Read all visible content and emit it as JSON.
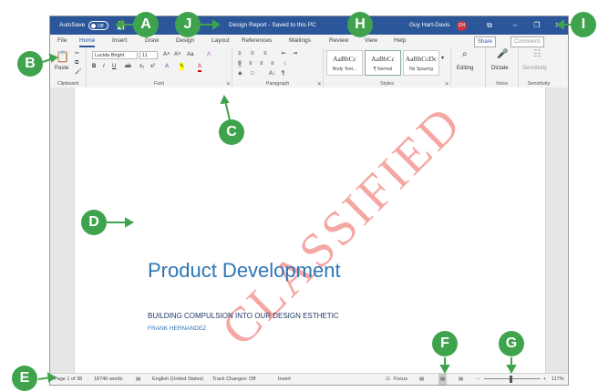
{
  "titlebar": {
    "autosave": "AutoSave",
    "autosave_state": "Off",
    "save_icon": "save-icon",
    "document_title": "Design Report - Saved to this PC",
    "user_name": "Guy Hart-Davis",
    "user_initials": "GH",
    "ribbon_display_glyph": "⧉",
    "minimize_glyph": "–",
    "restore_glyph": "❐",
    "close_glyph": "✕"
  },
  "tabs": [
    "File",
    "Home",
    "Insert",
    "Draw",
    "Design",
    "Layout",
    "References",
    "Mailings",
    "Review",
    "View",
    "Help"
  ],
  "active_tab": "Home",
  "share_label": "Share",
  "comments_label": "Comments",
  "ribbon": {
    "clipboard": {
      "label": "Clipboard",
      "paste": "Paste"
    },
    "font": {
      "label": "Font",
      "name": "Lucida Bright",
      "size": "11",
      "grow": "A˄",
      "shrink": "A˅",
      "case": "Aa",
      "clear": "A",
      "bold": "B",
      "italic": "I",
      "underline": "U",
      "strike": "ab",
      "subscript": "x₂",
      "superscript": "x²",
      "effects": "A",
      "highlight": "✎",
      "color": "A"
    },
    "paragraph": {
      "label": "Paragraph",
      "pilcrow": "¶",
      "sort": "A↓"
    },
    "styles": {
      "label": "Styles",
      "items": [
        {
          "sample": "AaBbCc",
          "name": "Body Text..."
        },
        {
          "sample": "AaBbCc",
          "name": "¶ Normal"
        },
        {
          "sample": "AaBbCcDc",
          "name": "No Spacing"
        }
      ]
    },
    "editing": "Editing",
    "dictate": "Dictate",
    "voice_label": "Voice",
    "sensitivity": "Sensitivity",
    "sensitivity_label": "Sensitivity"
  },
  "document": {
    "watermark": "CLASSIFIED",
    "heading": "Product Development",
    "subheading": "BUILDING COMPULSION INTO OUR DESIGN ESTHETIC",
    "author": "FRANK HERNANDEZ"
  },
  "status": {
    "page": "Page 1 of 38",
    "words": "18746 words",
    "language": "English (United States)",
    "track": "Track Changes: Off",
    "mode": "Insert",
    "focus": "Focus",
    "zoom": "117%"
  },
  "callouts": {
    "a": "A",
    "b": "B",
    "c": "C",
    "d": "D",
    "e": "E",
    "f": "F",
    "g": "G",
    "h": "H",
    "i": "I",
    "j": "J"
  },
  "colors": {
    "titlebar": "#2b579a",
    "callout": "#3fa34d",
    "heading": "#2e75b6",
    "watermark": "#e63c32"
  }
}
